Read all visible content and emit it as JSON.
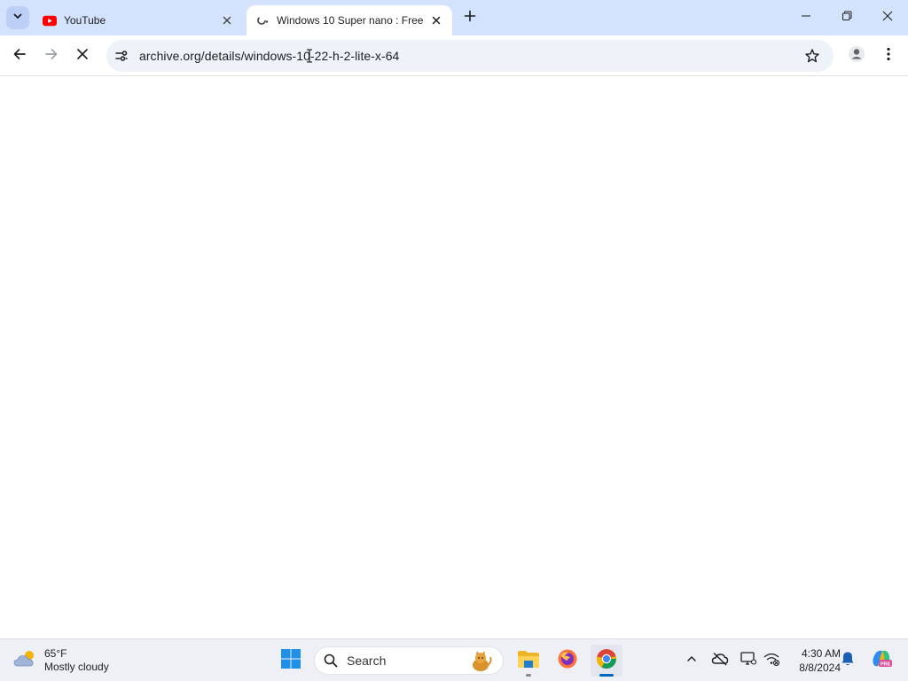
{
  "browser": {
    "tabs": [
      {
        "title": "YouTube",
        "favicon": "youtube-icon",
        "active": false
      },
      {
        "title": "Windows 10 Super nano : Free",
        "favicon": "loading-icon",
        "active": true
      }
    ],
    "address_bar": {
      "url": "archive.org/details/windows-10-22-h-2-lite-x-64"
    },
    "window_controls": [
      "minimize-icon",
      "restore-icon",
      "close-icon"
    ]
  },
  "taskbar": {
    "weather": {
      "temperature": "65°F",
      "condition": "Mostly cloudy",
      "icon": "partly-cloudy-icon"
    },
    "search": {
      "label": "Search"
    },
    "pinned_apps": [
      "start-icon",
      "file-explorer-icon",
      "firefox-icon",
      "chrome-icon"
    ],
    "tray_icons": [
      "chevron-up-icon",
      "onedrive-offline-icon",
      "display-icon",
      "network-icon",
      "notification-bell-icon",
      "copilot-icon"
    ],
    "clock": {
      "time": "4:30 AM",
      "date": "8/8/2024"
    }
  },
  "colors": {
    "tabstrip_bg": "#d3e3fd",
    "omnibox_bg": "#eef2f9",
    "taskbar_bg": "#eef0f5",
    "accent": "#0067c0",
    "youtube_red": "#ff0000"
  }
}
